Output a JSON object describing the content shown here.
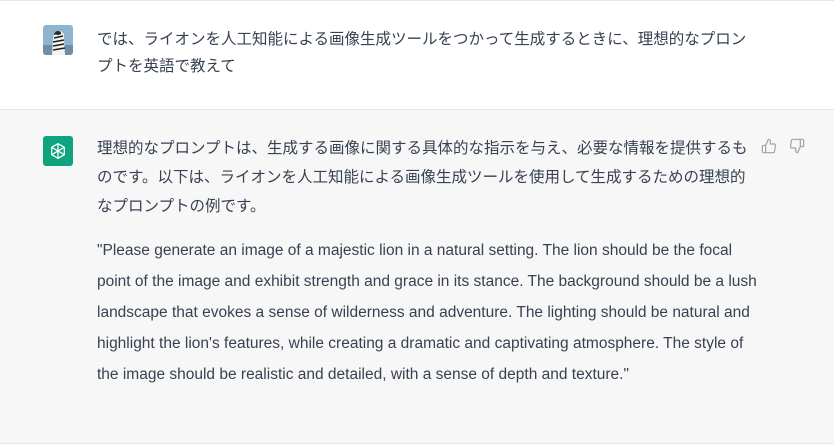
{
  "conversation": {
    "user_message": {
      "text": "では、ライオンを人工知能による画像生成ツールをつかって生成するときに、理想的なプロンプトを英語で教えて"
    },
    "assistant_message": {
      "intro": "理想的なプロンプトは、生成する画像に関する具体的な指示を与え、必要な情報を提供するものです。以下は、ライオンを人工知能による画像生成ツールを使用して生成するための理想的なプロンプトの例です。",
      "quote": "\"Please generate an image of a majestic lion in a natural setting. The lion should be the focal point of the image and exhibit strength and grace in its stance. The background should be a lush landscape that evokes a sense of wilderness and adventure. The lighting should be natural and highlight the lion's features, while creating a dramatic and captivating atmosphere. The style of the image should be realistic and detailed, with a sense of depth and texture.\""
    }
  },
  "icons": {
    "user_avatar": "zebra-avatar-icon",
    "assistant_avatar": "openai-logo-icon",
    "thumbs_up": "thumbs-up-icon",
    "thumbs_down": "thumbs-down-icon"
  },
  "colors": {
    "assistant_bg": "#f7f7f8",
    "brand": "#10a37f",
    "text": "#374151"
  }
}
